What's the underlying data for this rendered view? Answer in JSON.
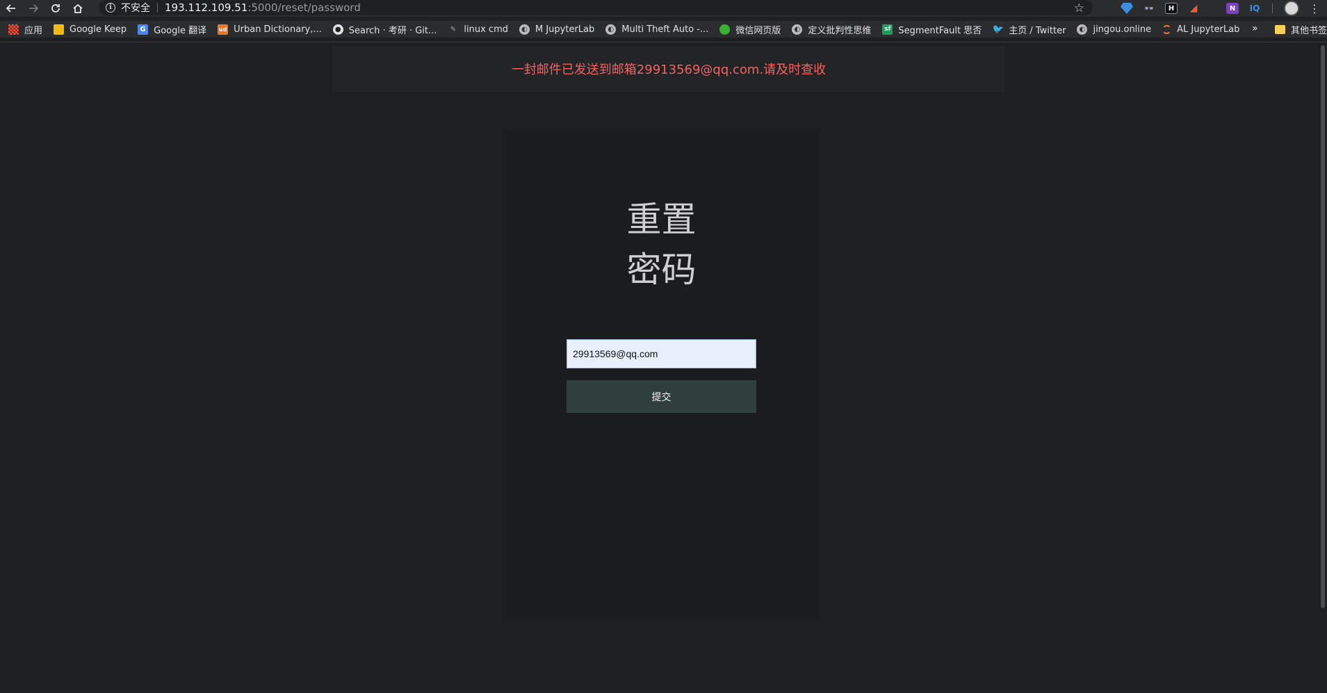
{
  "browser": {
    "security_label": "不安全",
    "url_host": "193.112.109.51",
    "url_rest": ":5000/reset/password",
    "extensions": [
      "diamond-ext",
      "eyes-ext",
      "h-ext",
      "flag-ext",
      "onenote-ext",
      "iq-ext"
    ],
    "extension_labels": {
      "h": "H",
      "onenote": "N",
      "iq": "IQ"
    }
  },
  "bookmarks": {
    "items": [
      {
        "label": "应用",
        "icon": "apps-grid-icon",
        "color": "#e05a47"
      },
      {
        "label": "Google Keep",
        "icon": "keep-icon",
        "color": "#f5ba14"
      },
      {
        "label": "Google 翻译",
        "icon": "translate-icon",
        "color": "#4a85f0"
      },
      {
        "label": "Urban Dictionary,...",
        "icon": "urban-dictionary-icon",
        "color": "#e8772e"
      },
      {
        "label": "Search · 考研 · Git...",
        "icon": "github-icon",
        "color": "#e2e2e2"
      },
      {
        "label": "linux cmd",
        "icon": "linux-cmd-icon",
        "color": "#555"
      },
      {
        "label": "M JupyterLab",
        "icon": "globe-icon",
        "color": "#bbb"
      },
      {
        "label": "Multi Theft Auto -...",
        "icon": "globe-icon",
        "color": "#bbb"
      },
      {
        "label": "微信网页版",
        "icon": "wechat-icon",
        "color": "#3cb034"
      },
      {
        "label": "定义批判性思维",
        "icon": "globe-icon",
        "color": "#bbb"
      },
      {
        "label": "SegmentFault 思否",
        "icon": "segmentfault-icon",
        "color": "#1f9c5a"
      },
      {
        "label": "主页 / Twitter",
        "icon": "twitter-icon",
        "color": "#1da1f2"
      },
      {
        "label": "jingou.online",
        "icon": "globe-icon",
        "color": "#bbb"
      },
      {
        "label": "AL JupyterLab",
        "icon": "jupyter-icon",
        "color": "#f37726"
      }
    ],
    "more_label": "»",
    "other_label": "其他书签"
  },
  "flash": {
    "message": "一封邮件已发送到邮箱29913569@qq.com.请及时查收",
    "color": "#f36262"
  },
  "form": {
    "title_line1": "重置",
    "title_line2": "密码",
    "email_value": "29913569@qq.com",
    "submit_label": "提交"
  }
}
